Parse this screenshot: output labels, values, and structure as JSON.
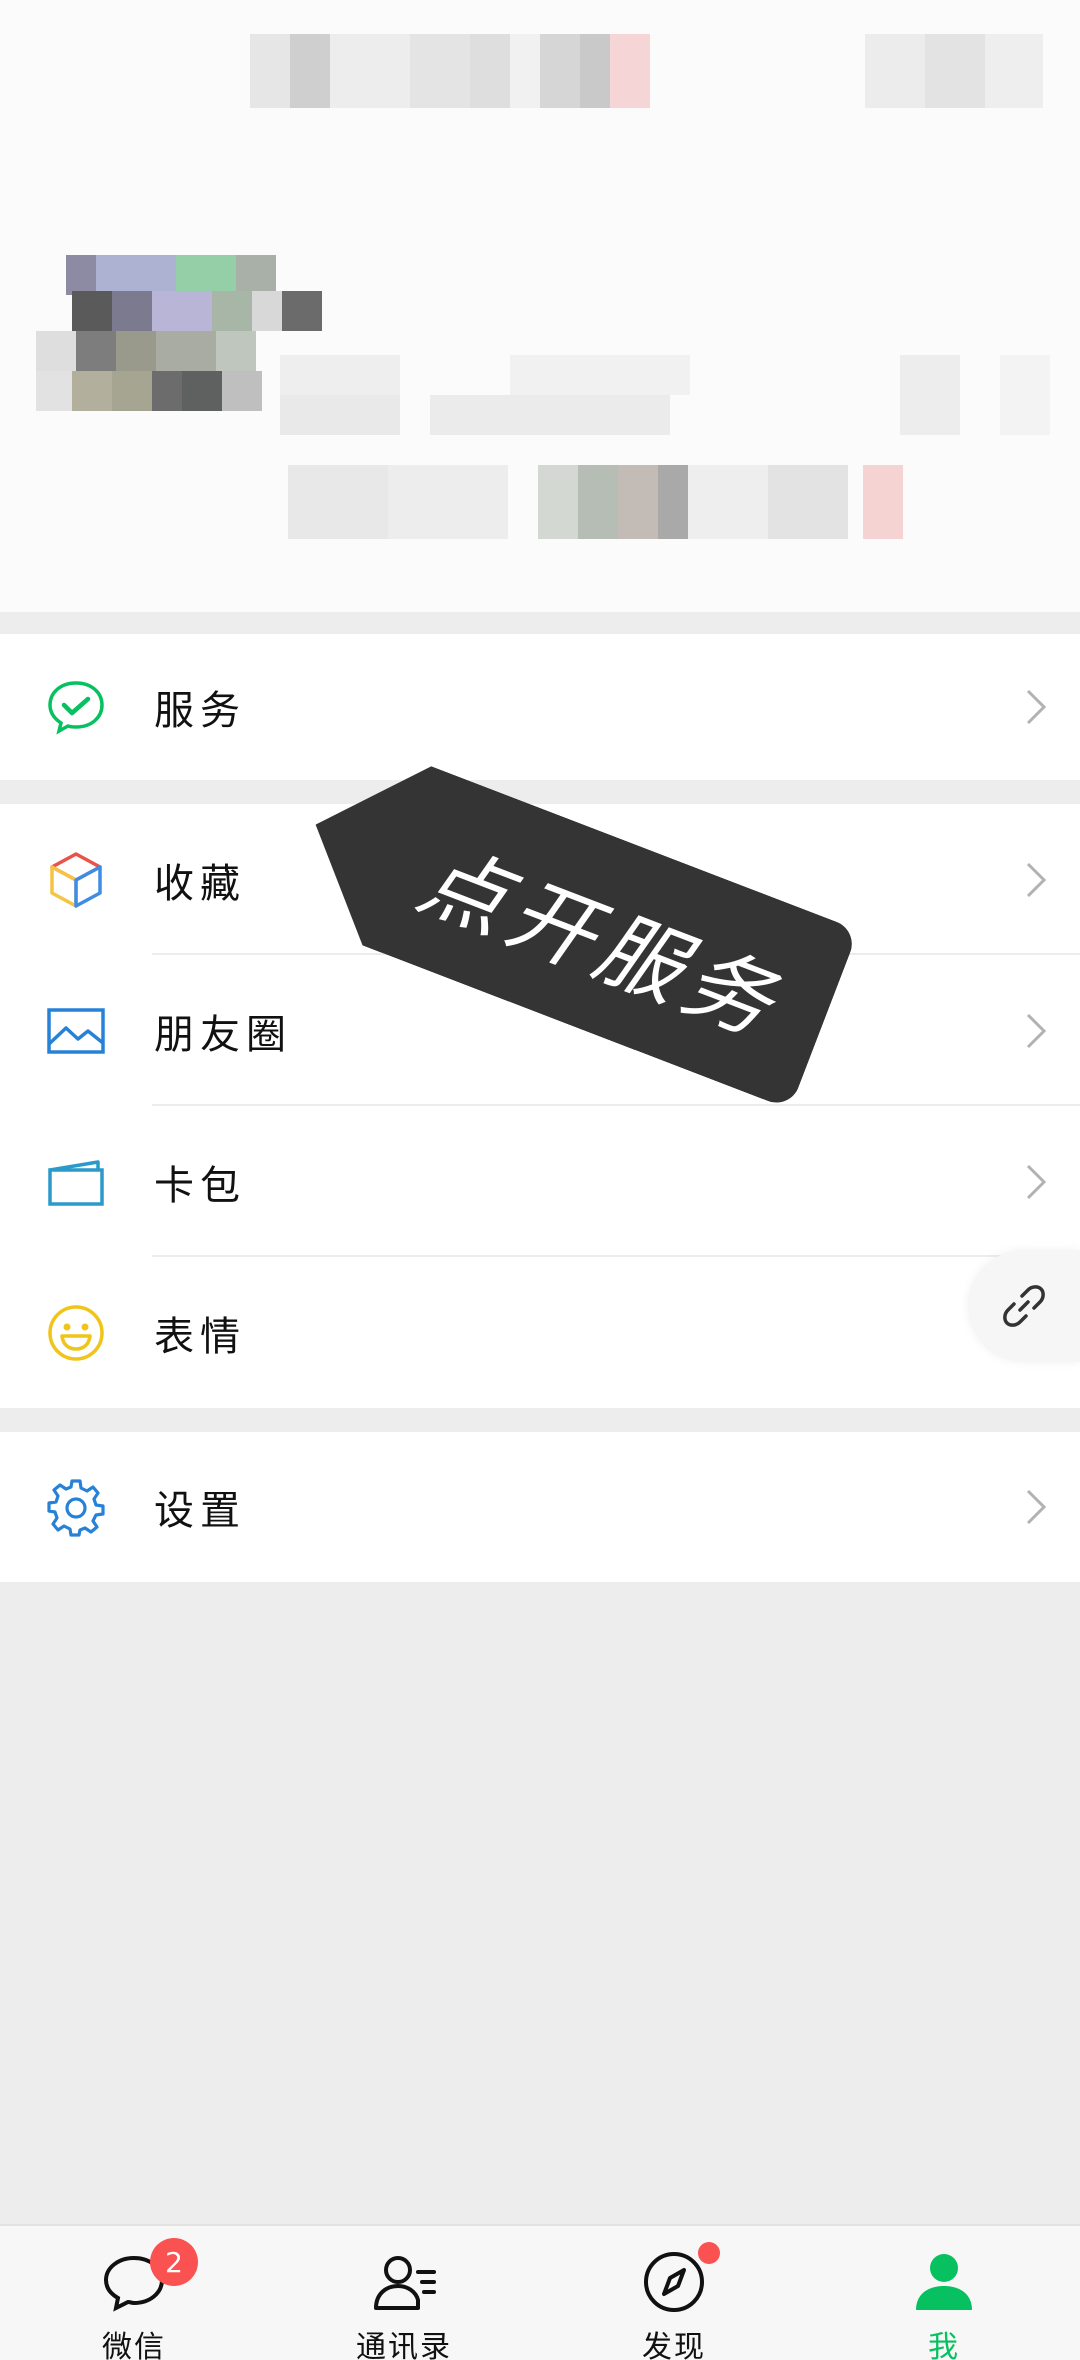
{
  "menu": {
    "service": "服务",
    "favorites": "收藏",
    "moments": "朋友圈",
    "cards": "卡包",
    "stickers": "表情",
    "settings": "设置"
  },
  "overlay": {
    "sticker_text": "点开服务"
  },
  "tabs": [
    {
      "label": "微信",
      "badge": "2"
    },
    {
      "label": "通讯录"
    },
    {
      "label": "发现"
    },
    {
      "label": "我"
    }
  ],
  "colors": {
    "accent": "#07c160",
    "badge": "#fa5151",
    "icon_blue": "#2782d7"
  }
}
